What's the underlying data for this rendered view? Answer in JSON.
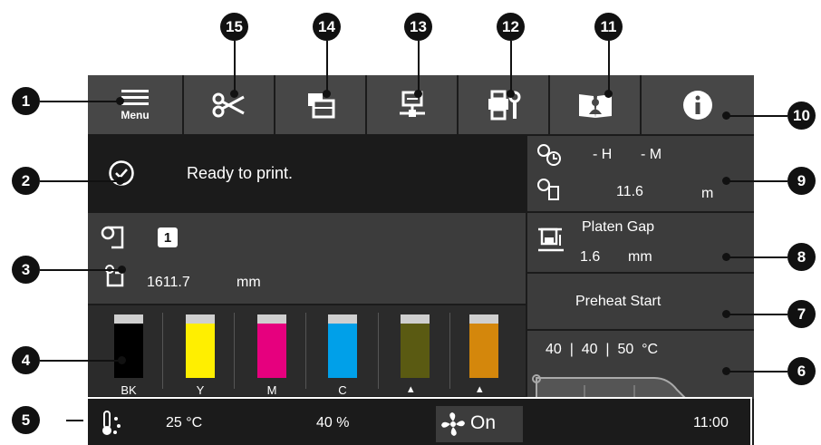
{
  "toolbar": {
    "menu_label": "Menu",
    "icons": [
      "menu-icon",
      "scissors-icon",
      "paper-overlay-icon",
      "network-icon",
      "printer-maintenance-icon",
      "user-guide-icon",
      "info-icon"
    ]
  },
  "status": {
    "message": "Ready to print."
  },
  "media": {
    "roll_number": "1",
    "remaining_length": "1611.7",
    "remaining_unit": "mm"
  },
  "timer": {
    "time_hours": "- H",
    "time_minutes": "- M",
    "length_value": "11.6",
    "length_unit": "m"
  },
  "platen": {
    "title": "Platen Gap",
    "value": "1.6",
    "unit": "mm"
  },
  "preheat": {
    "label": "Preheat Start"
  },
  "heaters": {
    "temps": "40  |  40  |  50  °C"
  },
  "inks": [
    {
      "label": "BK",
      "color": "#000000",
      "level": 0.86
    },
    {
      "label": "Y",
      "color": "#ffef00",
      "level": 0.86
    },
    {
      "label": "M",
      "color": "#e6007e",
      "level": 0.86
    },
    {
      "label": "C",
      "color": "#00a0e9",
      "level": 0.86
    },
    {
      "label": "",
      "color": "#5a5a12",
      "level": 0.86
    },
    {
      "label": "",
      "color": "#d4870c",
      "level": 0.86
    }
  ],
  "footer": {
    "temperature": "25 °C",
    "humidity": "40 %",
    "fan_state": "On",
    "time": "11:00"
  },
  "callouts": [
    "1",
    "2",
    "3",
    "4",
    "5",
    "6",
    "7",
    "8",
    "9",
    "10",
    "11",
    "12",
    "13",
    "14",
    "15"
  ]
}
